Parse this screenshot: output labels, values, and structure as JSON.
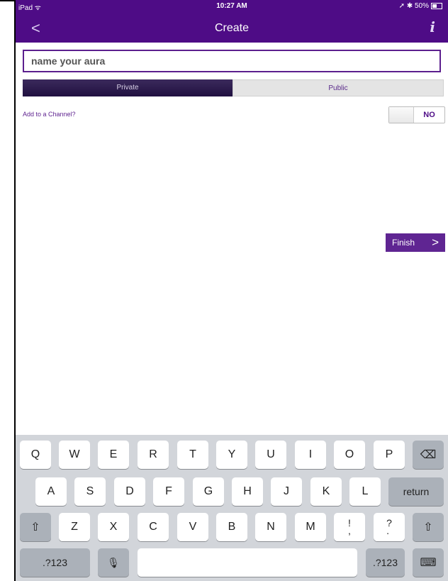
{
  "status_bar": {
    "device": "iPad",
    "time": "10:27 AM",
    "battery": "50%",
    "signal_icon": "wifi-icon",
    "indicators": "location-icon bluetooth-icon"
  },
  "nav": {
    "title": "Create",
    "back_icon": "<",
    "info_icon": "i"
  },
  "name_input": {
    "placeholder": "name your aura",
    "value": ""
  },
  "privacy_toggle": {
    "options": [
      "Private",
      "Public"
    ],
    "selected": "Private"
  },
  "channel": {
    "label": "Add to a Channel?",
    "toggle_value": "NO"
  },
  "finish_button": {
    "label": "Finish",
    "arrow": ">"
  },
  "keyboard": {
    "row1": [
      "Q",
      "W",
      "E",
      "R",
      "T",
      "Y",
      "U",
      "I",
      "O",
      "P"
    ],
    "row2": [
      "A",
      "S",
      "D",
      "F",
      "G",
      "H",
      "J",
      "K",
      "L"
    ],
    "row3": [
      "Z",
      "X",
      "C",
      "V",
      "B",
      "N",
      "M"
    ],
    "punct_excl": "!\n,",
    "punct_q": "?\n.",
    "return_label": "return",
    "numbers_label": ".?123",
    "backspace_icon": "⌫",
    "shift_icon": "⇧",
    "mic_icon": "🎙",
    "hide_keyboard_icon": "⌨"
  },
  "colors": {
    "accent": "#4e0c86",
    "button": "#5f2592"
  }
}
